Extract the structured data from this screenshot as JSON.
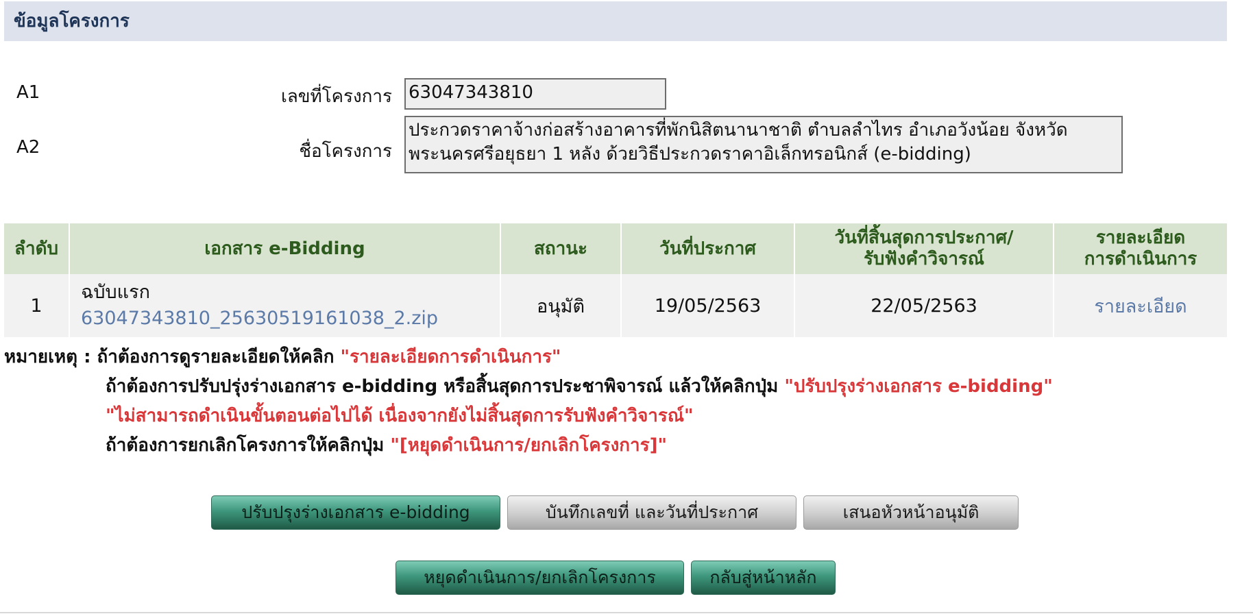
{
  "section": {
    "title": "ข้อมูลโครงการ"
  },
  "fields": [
    {
      "code": "A1",
      "label": "เลขที่โครงการ",
      "value": "63047343810"
    },
    {
      "code": "A2",
      "label": "ชื่อโครงการ",
      "value": "ประกวดราคาจ้างก่อสร้างอาคารที่พักนิสิตนานาชาติ ตำบลลำไทร อำเภอวังน้อย จังหวัดพระนครศรีอยุธยา 1 หลัง ด้วยวิธีประกวดราคาอิเล็กทรอนิกส์ (e-bidding)"
    }
  ],
  "table": {
    "headers": {
      "index": "ลำดับ",
      "document": "เอกสาร e-Bidding",
      "status": "สถานะ",
      "announce_date": "วันที่ประกาศ",
      "end_date_line1": "วันที่สิ้นสุดการประกาศ/",
      "end_date_line2": "รับฟังคำวิจารณ์",
      "detail_line1": "รายละเอียด",
      "detail_line2": "การดำเนินการ"
    },
    "rows": [
      {
        "index": "1",
        "doc_title": "ฉบับแรก",
        "doc_file": "63047343810_25630519161038_2.zip",
        "status": "อนุมัติ",
        "announce_date": "19/05/2563",
        "end_date": "22/05/2563",
        "detail_link": "รายละเอียด"
      }
    ]
  },
  "notes": {
    "line1_prefix": "หมายเหตุ : ถ้าต้องการดูรายละเอียดให้คลิก ",
    "line1_highlight": "\"รายละเอียดการดำเนินการ\"",
    "line2_prefix": "ถ้าต้องการปรับปรุ่งร่างเอกสาร e-bidding หรือสิ้นสุดการประชาพิจารณ์ แล้วให้คลิกปุ่ม ",
    "line2_highlight": "\"ปรับปรุงร่างเอกสาร e-bidding\"",
    "line3_highlight": "\"ไม่สามารถดำเนินขั้นตอนต่อไปได้ เนื่องจากยังไม่สิ้นสุดการรับฟังคำวิจารณ์\"",
    "line4_prefix": "ถ้าต้องการยกเลิกโครงการให้คลิกปุ่ม ",
    "line4_highlight": "\"[หยุดดำเนินการ/ยกเลิกโครงการ]\""
  },
  "buttons": {
    "update_draft": "ปรับปรุงร่างเอกสาร e-bidding",
    "save_number_date": "บันทึกเลขที่ และวันที่ประกาศ",
    "propose_approval": "เสนอหัวหน้าอนุมัติ",
    "stop_cancel": "หยุดดำเนินการ/ยกเลิกโครงการ",
    "back_home": "กลับสู่หน้าหลัก"
  },
  "colors": {
    "header_bg": "#dde2ec",
    "table_header_bg": "#d8e4cf",
    "table_header_text": "#2d5a1d",
    "link": "#5b7aa8",
    "highlight_red": "#d9383a",
    "button_green": "#3e977c",
    "button_gray": "#cdcdcd"
  }
}
